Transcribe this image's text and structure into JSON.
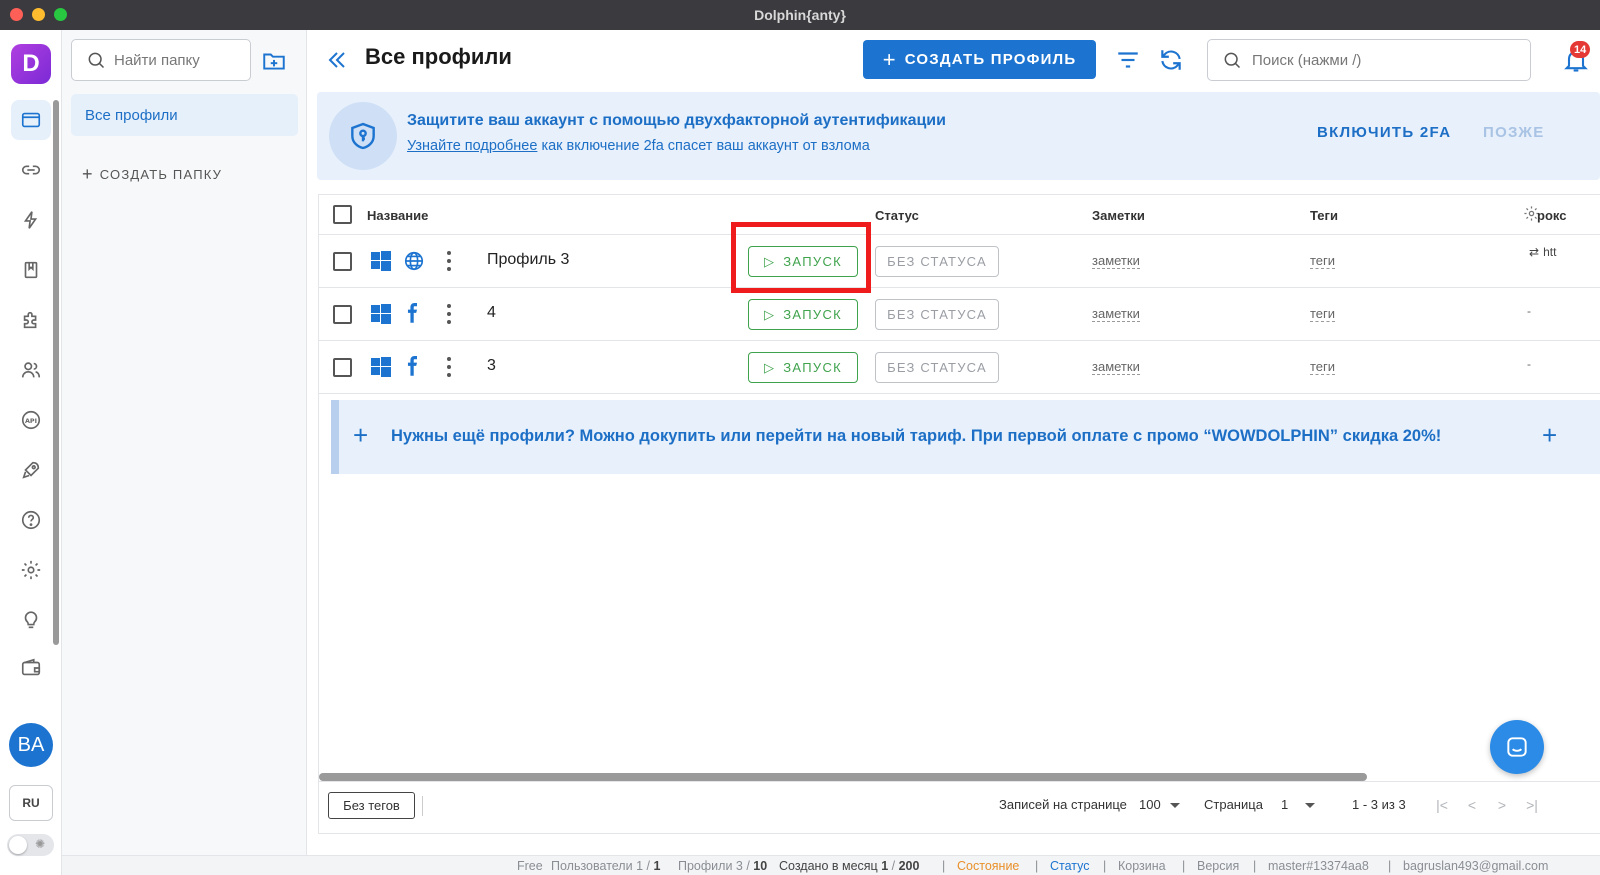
{
  "window": {
    "title": "Dolphin{anty}"
  },
  "logo": {
    "letter": "D"
  },
  "rail": {
    "items": [
      {
        "icon": "browser-window-icon",
        "active": true
      },
      {
        "icon": "link-icon"
      },
      {
        "icon": "automation-icon"
      },
      {
        "icon": "bookmarks-icon"
      },
      {
        "icon": "extensions-puzzle-icon"
      },
      {
        "icon": "users-icon"
      },
      {
        "icon": "api-icon"
      },
      {
        "icon": "rocket-icon"
      },
      {
        "icon": "help-icon"
      },
      {
        "icon": "settings-gear-icon"
      },
      {
        "icon": "lightbulb-icon"
      },
      {
        "icon": "wallet-icon"
      }
    ],
    "avatar_initials": "BA",
    "language": "RU"
  },
  "folders": {
    "search_placeholder": "Найти папку",
    "all_profiles": "Все профили",
    "create_folder": "СОЗДАТЬ ПАПКУ"
  },
  "header": {
    "title": "Все профили",
    "create_profile": "СОЗДАТЬ ПРОФИЛЬ",
    "search_placeholder": "Поиск (нажми /)",
    "notifications_count": "14"
  },
  "banner": {
    "title": "Защитите ваш аккаунт с помощью двухфакторной аутентификации",
    "link": "Узнайте подробнее",
    "sub": " как включение 2fa спасет ваш аккаунт от взлома",
    "enable": "ВКЛЮЧИТЬ 2FA",
    "later": "ПОЗЖЕ"
  },
  "table": {
    "columns": {
      "name": "Название",
      "status": "Статус",
      "notes": "Заметки",
      "tags": "Теги",
      "proxy": "рокс"
    },
    "rows": [
      {
        "name": "Профиль 3",
        "browser_icon": "globe-icon",
        "run": "ЗАПУСК",
        "status": "БЕЗ СТАТУСА",
        "notes": "заметки",
        "tags": "теги",
        "proxy": "htt"
      },
      {
        "name": "4",
        "browser_icon": "facebook-icon",
        "run": "ЗАПУСК",
        "status": "БЕЗ СТАТУСА",
        "notes": "заметки",
        "tags": "теги",
        "proxy": "-"
      },
      {
        "name": "3",
        "browser_icon": "facebook-icon",
        "run": "ЗАПУСК",
        "status": "БЕЗ СТАТУСА",
        "notes": "заметки",
        "tags": "теги",
        "proxy": "-"
      }
    ],
    "promo": "Нужны ещё профили? Можно докупить или перейти на новый тариф. При первой оплате с промо “WOWDOLPHIN” скидка 20%!"
  },
  "footer": {
    "no_tags": "Без тегов",
    "per_page_label": "Записей на странице",
    "per_page_value": "100",
    "page_label": "Страница",
    "page_value": "1",
    "range": "1 - 3 из 3"
  },
  "statusbar": {
    "plan": "Free",
    "users_label": "Пользователи",
    "users_used": "1",
    "users_total": "1",
    "profiles_label": "Профили",
    "profiles_used": "3",
    "profiles_total": "10",
    "monthly_label": "Создано в месяц",
    "monthly_used": "1",
    "monthly_total": "200",
    "state": "Состояние",
    "status": "Статус",
    "trash": "Корзина",
    "version": "Версия",
    "build": "master#13374aa8",
    "email": "bagruslan493@gmail.com"
  },
  "colors": {
    "accent": "#1d74d0",
    "run_green": "#3fa34d",
    "highlight_red": "#ee1c1c",
    "notification_red": "#e53935"
  }
}
